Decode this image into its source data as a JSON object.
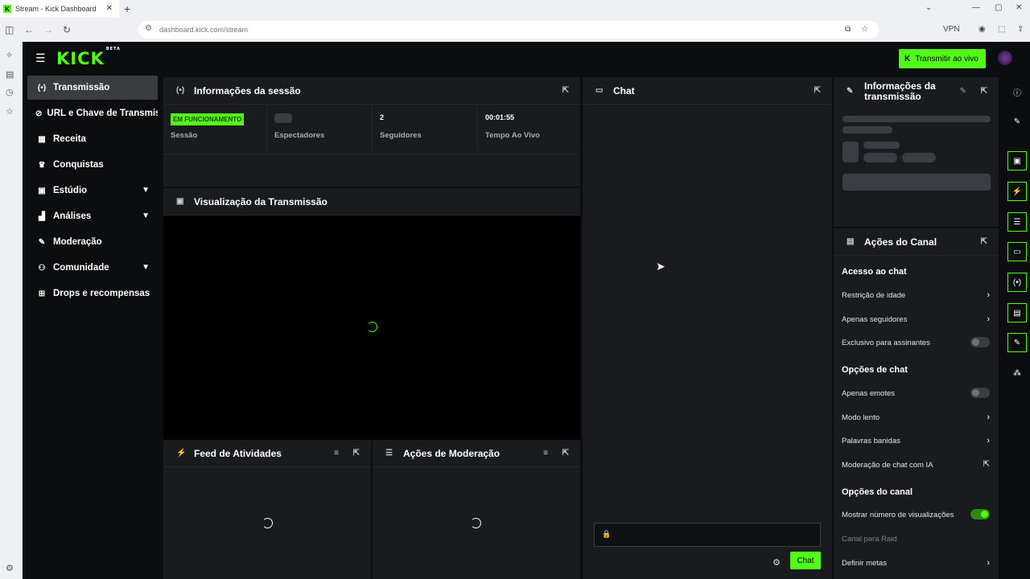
{
  "browser": {
    "tab_title": "Stream - Kick Dashboard",
    "url": "dashboard.kick.com/stream",
    "vpn_label": "VPN"
  },
  "topbar": {
    "logo": "KICK",
    "logo_sup": "BETA",
    "golive_label": "Transmitir ao vivo"
  },
  "sidebar": {
    "items": [
      {
        "label": "Transmissão",
        "icon": "broadcast-icon"
      },
      {
        "label": "URL e Chave de Transmissão",
        "icon": "link-icon"
      },
      {
        "label": "Receita",
        "icon": "chart-icon"
      },
      {
        "label": "Conquistas",
        "icon": "trophy-icon"
      },
      {
        "label": "Estúdio",
        "icon": "studio-icon"
      },
      {
        "label": "Análises",
        "icon": "analytics-icon"
      },
      {
        "label": "Moderação",
        "icon": "wrench-icon"
      },
      {
        "label": "Comunidade",
        "icon": "community-icon"
      },
      {
        "label": "Drops e recompensas",
        "icon": "drops-icon"
      }
    ]
  },
  "session": {
    "title": "Informações da sessão",
    "status_badge": "EM FUNCIONAMENTO",
    "stats": [
      {
        "label": "Sessão",
        "value": ""
      },
      {
        "label": "Espectadores",
        "value": ""
      },
      {
        "label": "Seguidores",
        "value": "2"
      },
      {
        "label": "Tempo Ao Vivo",
        "value": "00:01:55"
      }
    ]
  },
  "preview": {
    "title": "Visualização da Transmissão"
  },
  "feed": {
    "title": "Feed de Atividades"
  },
  "modactions": {
    "title": "Ações de Moderação"
  },
  "chat": {
    "title": "Chat",
    "send_label": "Chat"
  },
  "streaminfo": {
    "title": "Informações da transmissão"
  },
  "channel": {
    "title": "Ações do Canal",
    "sections": [
      {
        "label": "Acesso ao chat"
      },
      {
        "label": "Opções de chat"
      },
      {
        "label": "Opções do canal"
      }
    ],
    "items": [
      {
        "label": "Restrição de idade"
      },
      {
        "label": "Apenas seguidores"
      },
      {
        "label": "Exclusivo para assinantes",
        "toggle": false
      },
      {
        "label": "Apenas emotes",
        "toggle": false
      },
      {
        "label": "Modo lento"
      },
      {
        "label": "Palavras banidas"
      },
      {
        "label": "Moderação de chat com IA"
      },
      {
        "label": "Mostrar número de visualizações",
        "toggle": true
      },
      {
        "label": "Canal para Raid"
      },
      {
        "label": "Definir metas"
      }
    ]
  },
  "colors": {
    "accent": "#53fc18",
    "panel": "#191b1f",
    "bg": "#0b0d0e"
  }
}
